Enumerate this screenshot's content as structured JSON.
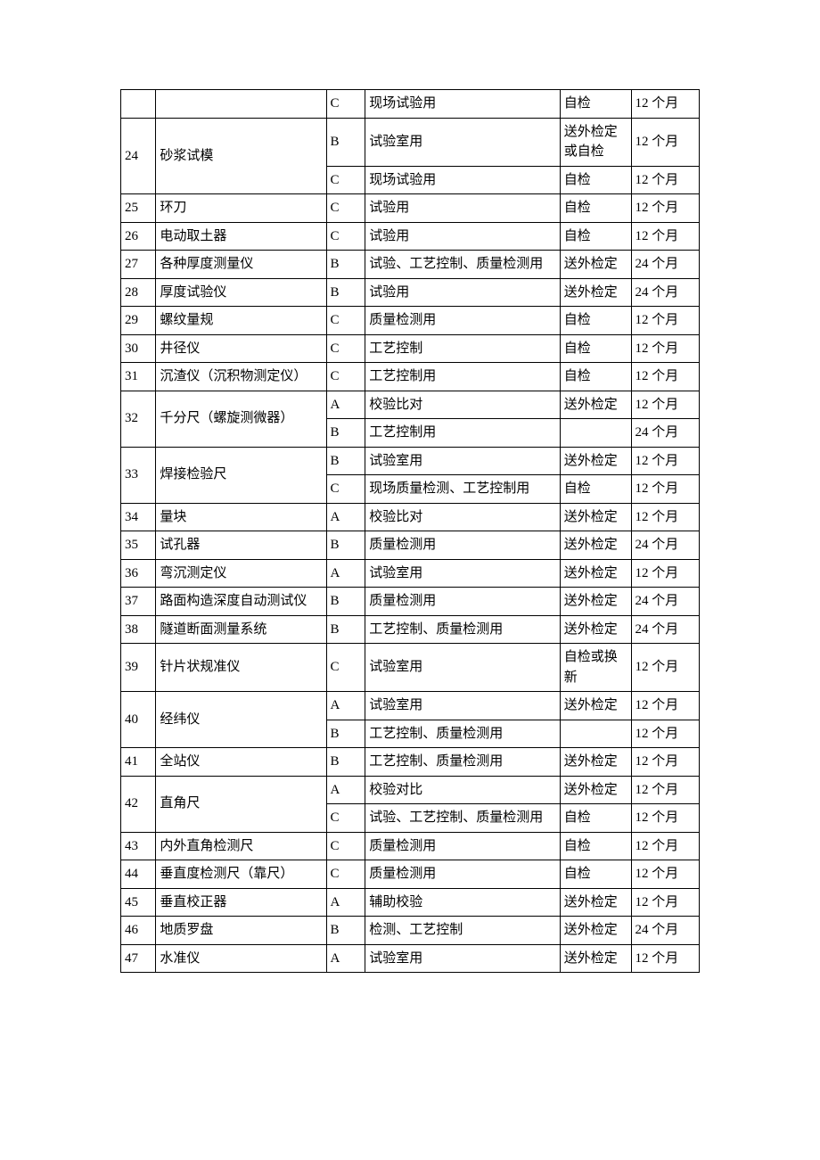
{
  "rows": [
    {
      "num": "",
      "name": "",
      "grade": "C",
      "usage": "现场试验用",
      "check": "自检",
      "period": "12 个月"
    },
    {
      "num": "24",
      "name": "砂浆试模",
      "grade": "B",
      "usage": "试验室用",
      "check": "送外检定或自检",
      "period": "12 个月",
      "rowspanNum": 2,
      "rowspanName": 2
    },
    {
      "grade": "C",
      "usage": "现场试验用",
      "check": "自检",
      "period": "12 个月"
    },
    {
      "num": "25",
      "name": "环刀",
      "grade": "C",
      "usage": "试验用",
      "check": "自检",
      "period": "12 个月"
    },
    {
      "num": "26",
      "name": "电动取土器",
      "grade": "C",
      "usage": "试验用",
      "check": "自检",
      "period": "12 个月"
    },
    {
      "num": "27",
      "name": "各种厚度测量仪",
      "grade": "B",
      "usage": "试验、工艺控制、质量检测用",
      "check": "送外检定",
      "period": "24 个月"
    },
    {
      "num": "28",
      "name": "厚度试验仪",
      "grade": "B",
      "usage": "试验用",
      "check": "送外检定",
      "period": "24 个月"
    },
    {
      "num": "29",
      "name": "螺纹量规",
      "grade": "C",
      "usage": "质量检测用",
      "check": "自检",
      "period": "12 个月"
    },
    {
      "num": "30",
      "name": "井径仪",
      "grade": "C",
      "usage": "工艺控制",
      "check": "自检",
      "period": "12 个月"
    },
    {
      "num": "31",
      "name": "沉渣仪（沉积物测定仪）",
      "grade": "C",
      "usage": "工艺控制用",
      "check": "自检",
      "period": "12 个月"
    },
    {
      "num": "32",
      "name": "千分尺（螺旋测微器）",
      "grade": "A",
      "usage": "校验比对",
      "check": "送外检定",
      "period": "12 个月",
      "rowspanNum": 2,
      "rowspanName": 2
    },
    {
      "grade": "B",
      "usage": "工艺控制用",
      "check": "",
      "period": "24 个月"
    },
    {
      "num": "33",
      "name": "焊接检验尺",
      "grade": "B",
      "usage": "试验室用",
      "check": "送外检定",
      "period": "12 个月",
      "rowspanNum": 2,
      "rowspanName": 2
    },
    {
      "grade": "C",
      "usage": "现场质量检测、工艺控制用",
      "check": "自检",
      "period": "12 个月"
    },
    {
      "num": "34",
      "name": "量块",
      "grade": "A",
      "usage": "校验比对",
      "check": "送外检定",
      "period": "12 个月"
    },
    {
      "num": "35",
      "name": "试孔器",
      "grade": "B",
      "usage": "质量检测用",
      "check": "送外检定",
      "period": "24 个月"
    },
    {
      "num": "36",
      "name": "弯沉测定仪",
      "grade": "A",
      "usage": "试验室用",
      "check": "送外检定",
      "period": "12 个月"
    },
    {
      "num": "37",
      "name": "路面构造深度自动测试仪",
      "grade": "B",
      "usage": "质量检测用",
      "check": "送外检定",
      "period": "24 个月"
    },
    {
      "num": "38",
      "name": "隧道断面测量系统",
      "grade": "B",
      "usage": "工艺控制、质量检测用",
      "check": "送外检定",
      "period": "24 个月"
    },
    {
      "num": "39",
      "name": "针片状规准仪",
      "grade": "C",
      "usage": "试验室用",
      "check": "自检或换新",
      "period": "12 个月"
    },
    {
      "num": "40",
      "name": "经纬仪",
      "grade": "A",
      "usage": "试验室用",
      "check": "送外检定",
      "period": "12 个月",
      "rowspanNum": 2,
      "rowspanName": 2
    },
    {
      "grade": "B",
      "usage": "工艺控制、质量检测用",
      "check": "",
      "period": "12 个月"
    },
    {
      "num": "41",
      "name": "全站仪",
      "grade": "B",
      "usage": "工艺控制、质量检测用",
      "check": "送外检定",
      "period": "12 个月"
    },
    {
      "num": "42",
      "name": "直角尺",
      "grade": "A",
      "usage": "校验对比",
      "check": "送外检定",
      "period": "12 个月",
      "rowspanNum": 2,
      "rowspanName": 2
    },
    {
      "grade": "C",
      "usage": "试验、工艺控制、质量检测用",
      "check": "自检",
      "period": "12 个月"
    },
    {
      "num": "43",
      "name": "内外直角检测尺",
      "grade": "C",
      "usage": "质量检测用",
      "check": "自检",
      "period": "12 个月"
    },
    {
      "num": "44",
      "name": "垂直度检测尺（靠尺）",
      "grade": "C",
      "usage": "质量检测用",
      "check": "自检",
      "period": "12 个月"
    },
    {
      "num": "45",
      "name": "垂直校正器",
      "grade": "A",
      "usage": "辅助校验",
      "check": "送外检定",
      "period": "12 个月"
    },
    {
      "num": "46",
      "name": "地质罗盘",
      "grade": "B",
      "usage": "检测、工艺控制",
      "check": "送外检定",
      "period": "24 个月"
    },
    {
      "num": "47",
      "name": "水准仪",
      "grade": "A",
      "usage": "试验室用",
      "check": "送外检定",
      "period": "12 个月"
    }
  ]
}
